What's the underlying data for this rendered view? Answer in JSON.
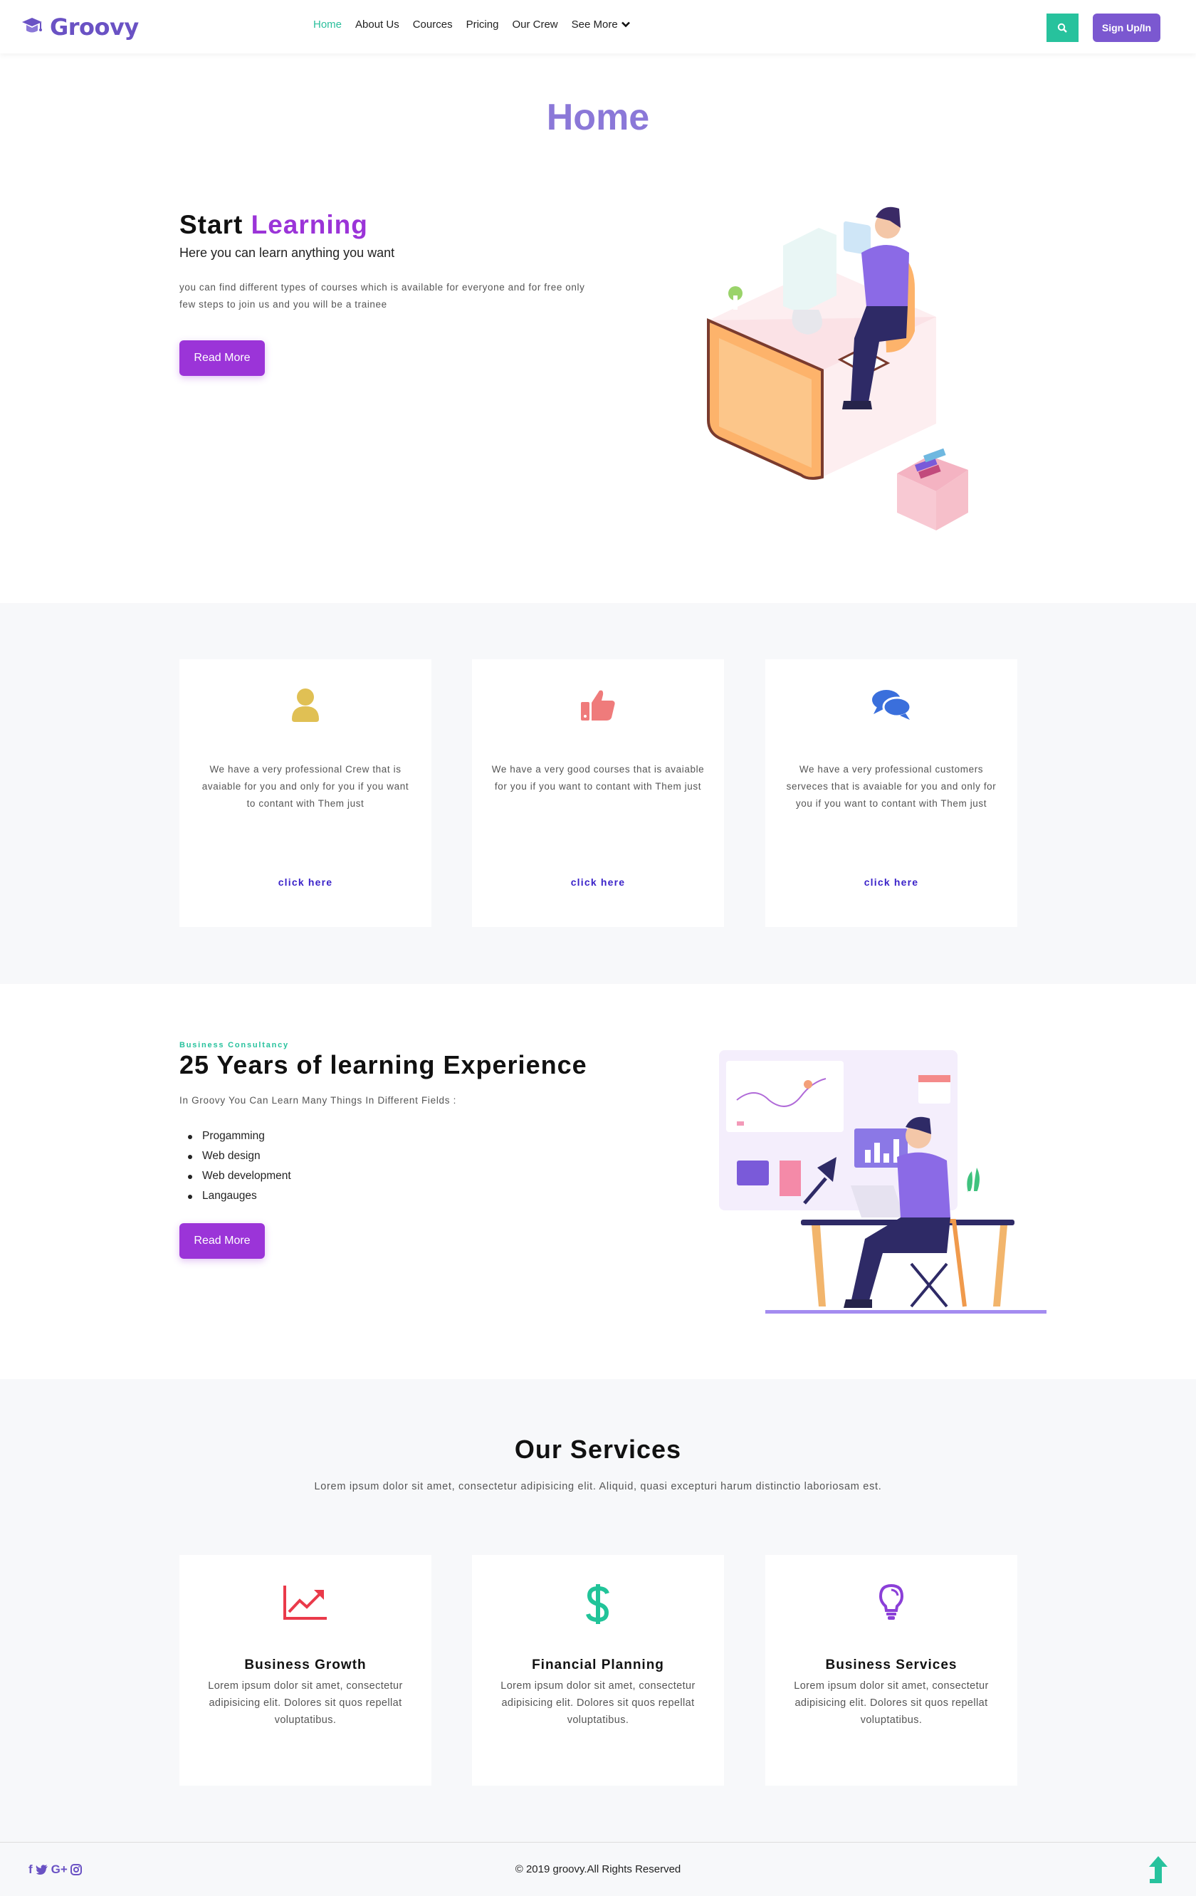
{
  "brand": {
    "name": "Groovy",
    "logo_icon": "logo-icon"
  },
  "nav": {
    "items": [
      {
        "label": "Home",
        "active": true
      },
      {
        "label": "About Us"
      },
      {
        "label": "Cources"
      },
      {
        "label": "Pricing"
      },
      {
        "label": "Our Crew"
      },
      {
        "label": "See More"
      }
    ],
    "search_icon": "search-icon",
    "signup_label": "Sign Up/In"
  },
  "hero": {
    "page_heading": "Home",
    "title_prefix": "Start",
    "title_accent": "Learning",
    "subtitle": "Here you can learn anything you want",
    "description": "you can find different types of courses which is available for everyone and for free only few steps to join us and you will be a trainee",
    "button_label": "Read More"
  },
  "features": [
    {
      "icon": "user-icon",
      "text": "We have a very professional Crew that is avaiable for you and only for you if you want to contant with Them just",
      "link": "click here"
    },
    {
      "icon": "thumbs-up-icon",
      "text": "We have a very good courses that is avaiable for you if you want to contant with Them just",
      "link": "click here"
    },
    {
      "icon": "comments-icon",
      "text": "We have a very professional customers serveces that is avaiable for you and only for you if you want to contant with Them just",
      "link": "click here"
    }
  ],
  "experience": {
    "kicker": "Business Consultancy",
    "title": "25 Years of learning Experience",
    "subtitle": "In Groovy You Can Learn Many Things In Different Fields :",
    "list": [
      "Progamming",
      "Web design",
      "Web development",
      "Langauges"
    ],
    "button_label": "Read More"
  },
  "services": {
    "title": "Our Services",
    "subtitle": "Lorem ipsum dolor sit amet, consectetur adipisicing elit. Aliquid, quasi excepturi harum distinctio laboriosam est.",
    "items": [
      {
        "icon": "chart-line-icon",
        "name": "Business Growth",
        "text": "Lorem ipsum dolor sit amet, consectetur adipisicing elit. Dolores sit quos repellat voluptatibus."
      },
      {
        "icon": "dollar-icon",
        "name": "Financial Planning",
        "text": "Lorem ipsum dolor sit amet, consectetur adipisicing elit. Dolores sit quos repellat voluptatibus."
      },
      {
        "icon": "lightbulb-icon",
        "name": "Business Services",
        "text": "Lorem ipsum dolor sit amet, consectetur adipisicing elit. Dolores sit quos repellat voluptatibus."
      }
    ]
  },
  "footer": {
    "social": [
      {
        "label": "f",
        "icon": "facebook-icon"
      },
      {
        "label": "twitter-bird",
        "icon": "twitter-icon"
      },
      {
        "label": "G+",
        "icon": "google-plus-icon"
      },
      {
        "label": "instagram",
        "icon": "instagram-icon"
      }
    ],
    "copyright": "© 2019 groovy.All Rights Reserved",
    "to_top_icon": "arrow-up-icon"
  },
  "colors": {
    "brand": "#6a52c4",
    "accent_purple": "#9b34d8",
    "accent_green": "#27c29d",
    "link_blue": "#3b23c9",
    "heading_lavender": "#8b78d8"
  }
}
